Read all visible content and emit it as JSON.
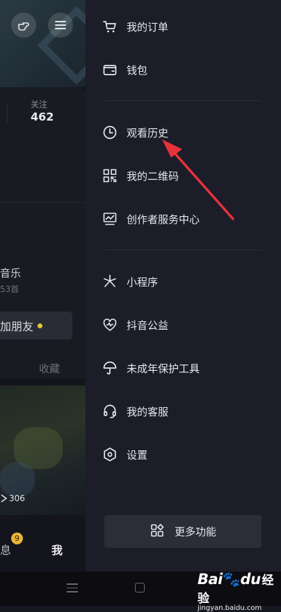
{
  "left_page": {
    "follow_label": "关注",
    "follow_count": "462",
    "music_title": "音乐",
    "music_count": "53首",
    "add_friend": "加朋友",
    "favorites_tab": "收藏",
    "play_count": "306",
    "tab_messages": "息",
    "message_badge": "9",
    "tab_me": "我"
  },
  "drawer": {
    "items": [
      {
        "label": "我的订单",
        "icon": "cart-icon"
      },
      {
        "label": "钱包",
        "icon": "wallet-icon"
      },
      {
        "label": "观看历史",
        "icon": "clock-icon"
      },
      {
        "label": "我的二维码",
        "icon": "qrcode-icon"
      },
      {
        "label": "创作者服务中心",
        "icon": "creator-chart-icon"
      },
      {
        "label": "小程序",
        "icon": "mini-program-icon"
      },
      {
        "label": "抖音公益",
        "icon": "heart-charity-icon"
      },
      {
        "label": "未成年保护工具",
        "icon": "umbrella-icon"
      },
      {
        "label": "我的客服",
        "icon": "headset-icon"
      },
      {
        "label": "设置",
        "icon": "settings-hexagon-icon"
      }
    ],
    "more_button": "更多功能"
  },
  "annotation": {
    "arrow_color": "#e8323a"
  },
  "watermark": {
    "brand": "Bai",
    "brand_suffix": "du",
    "product": "经验",
    "url": "jingyan.baidu.com"
  },
  "colors": {
    "drawer_bg": "#1c1d28",
    "accent_yellow": "#e9c534"
  }
}
